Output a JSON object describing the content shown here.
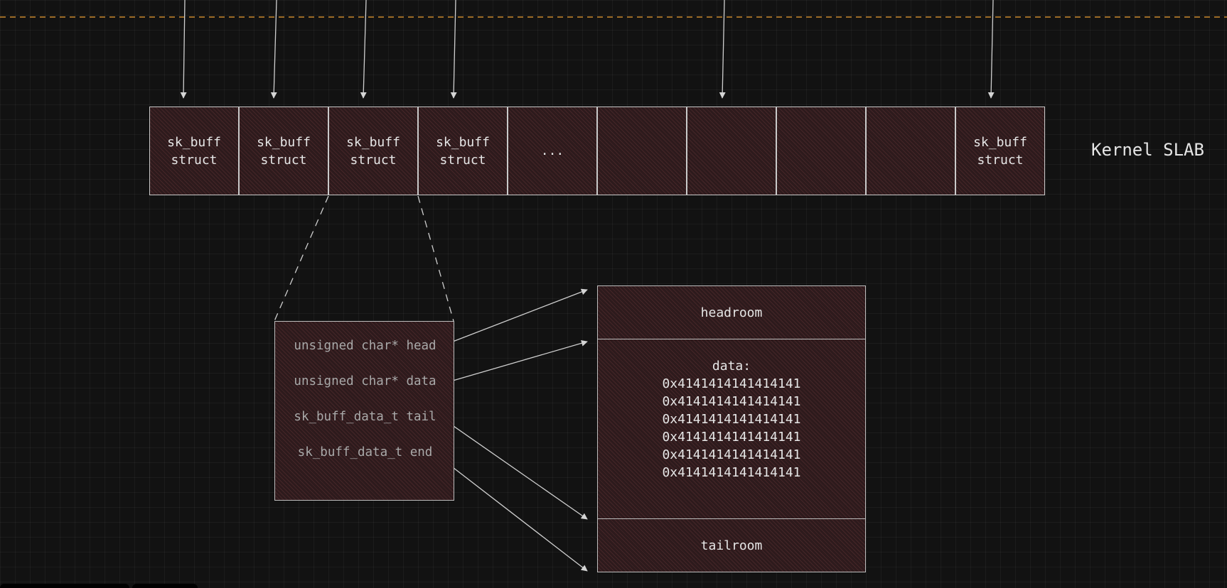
{
  "slab": {
    "label": "Kernel SLAB",
    "cells": [
      "sk_buff\nstruct",
      "sk_buff\nstruct",
      "sk_buff\nstruct",
      "sk_buff\nstruct",
      "...",
      "",
      "",
      "",
      "",
      "sk_buff\nstruct"
    ]
  },
  "sk_buff": {
    "fields": [
      "unsigned char* head",
      "unsigned char* data",
      "sk_buff_data_t tail",
      "sk_buff_data_t end"
    ]
  },
  "buffer": {
    "headroom": "headroom",
    "data_label": "data:",
    "data_lines": [
      "0x4141414141414141",
      "0x4141414141414141",
      "0x4141414141414141",
      "0x4141414141414141",
      "0x4141414141414141",
      "0x4141414141414141"
    ],
    "tailroom": "tailroom"
  },
  "colors": {
    "background": "#121212",
    "cell_fill": "#2d1a1c",
    "stroke": "#c9c9c9",
    "divider": "#c98a2e",
    "text": "#e6e6e6"
  }
}
